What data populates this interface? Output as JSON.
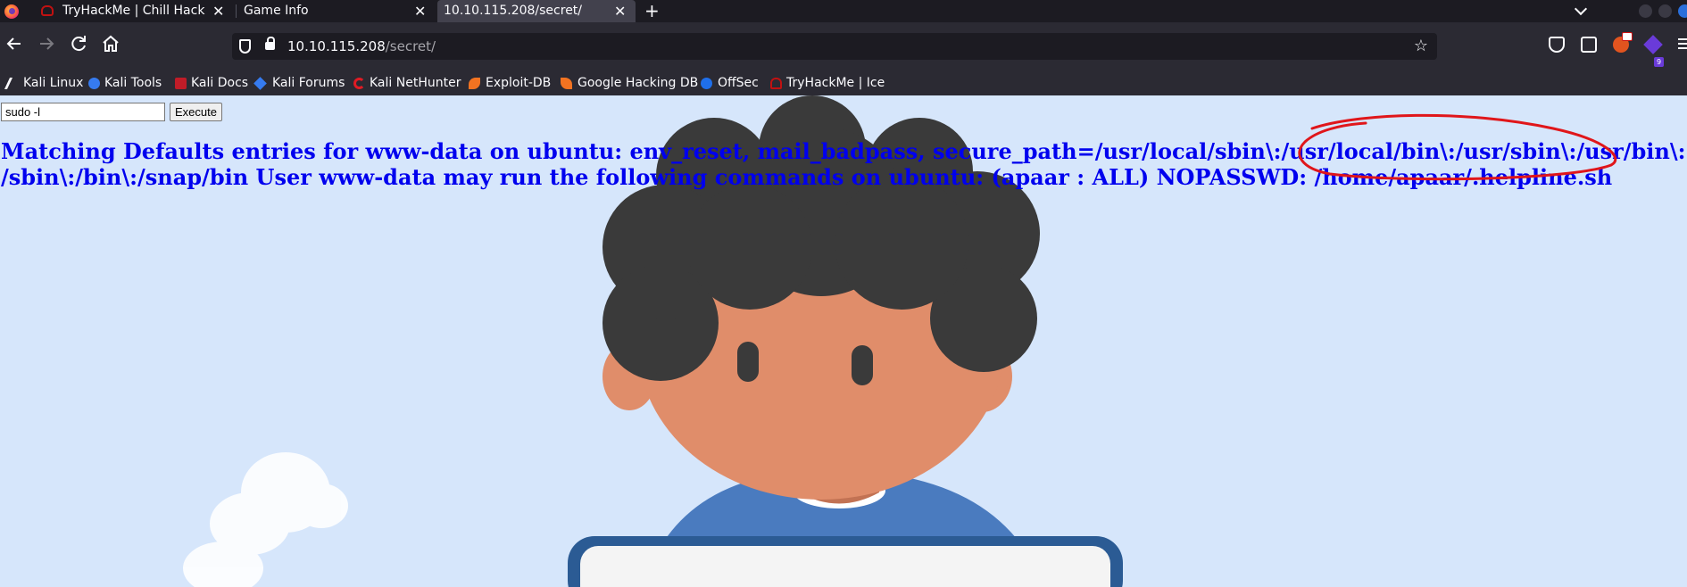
{
  "browser": {
    "tabs": [
      {
        "title": "TryHackMe | Chill Hack",
        "favicon": "tryhackme-icon",
        "active": false
      },
      {
        "title": "Game Info",
        "favicon": "",
        "active": false
      },
      {
        "title": "10.10.115.208/secret/",
        "favicon": "",
        "active": true
      }
    ],
    "close_glyph": "✕",
    "new_tab_glyph": "+",
    "url": {
      "host": "10.10.115.208",
      "path": "/secret/"
    },
    "bookmarks": [
      {
        "label": "Kali Linux",
        "icon": "kali-linux-icon"
      },
      {
        "label": "Kali Tools",
        "icon": "kali-tools-icon"
      },
      {
        "label": "Kali Docs",
        "icon": "kali-docs-icon"
      },
      {
        "label": "Kali Forums",
        "icon": "kali-forums-icon"
      },
      {
        "label": "Kali NetHunter",
        "icon": "kali-nethunter-icon"
      },
      {
        "label": "Exploit-DB",
        "icon": "exploit-db-icon"
      },
      {
        "label": "Google Hacking DB",
        "icon": "google-hacking-db-icon"
      },
      {
        "label": "OffSec",
        "icon": "offsec-icon"
      },
      {
        "label": "TryHackMe | Ice",
        "icon": "tryhackme-icon"
      }
    ],
    "extension_badge": "9",
    "colors": {
      "tab_bar": "#1c1b22",
      "toolbar": "#2b2a33",
      "active_tab": "#42414d",
      "text": "#fbfbfe"
    }
  },
  "page": {
    "command_value": "sudo -l",
    "execute_label": "Execute",
    "output_lines": [
      "Matching Defaults entries for www-data on ubuntu: env_reset, mail_badpass, secure_path=/usr/local/sbin\\:/usr/local/bin\\:/usr/sbin\\:/usr/bin\\:",
      "/sbin\\:/bin\\:/snap/bin User www-data may run the following commands on ubuntu: (apaar : ALL) NOPASSWD: /home/apaar/.helpline.sh"
    ],
    "colors": {
      "background": "#d6e6fb",
      "output_text": "#0000ee",
      "annotation": "#e0161a"
    }
  }
}
